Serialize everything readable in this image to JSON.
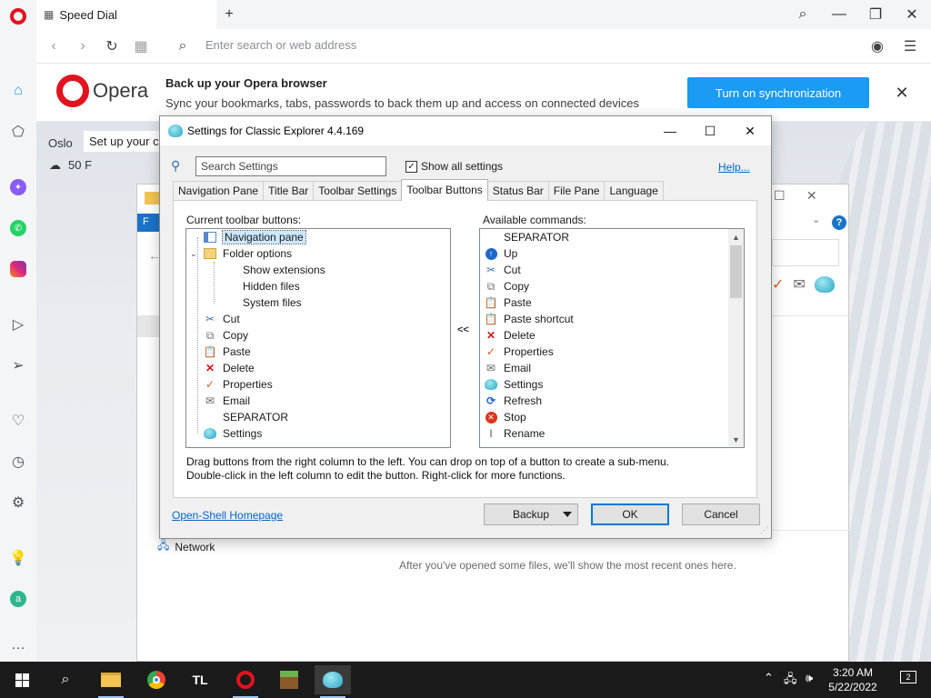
{
  "browser": {
    "tab_title": "Speed Dial",
    "address_placeholder": "Enter search or web address",
    "banner": {
      "logo_text": "Opera",
      "title": "Back up your Opera browser",
      "description": "Sync your bookmarks, tabs, passwords to back them up and access on connected devices",
      "button": "Turn on synchronization"
    },
    "weather": {
      "city": "Oslo",
      "hint": "Set up your city",
      "temperature": "50 F"
    },
    "accent": "#e0131f"
  },
  "explorer_window": {
    "ribbon_label": "F",
    "network_label": "Network",
    "recent_message": "After you've opened some files, we'll show the most recent ones here."
  },
  "dialog": {
    "title": "Settings for Classic Explorer 4.4.169",
    "search_placeholder": "Search Settings",
    "show_all_label": "Show all settings",
    "show_all_checked": true,
    "help_link": "Help...",
    "tabs": [
      {
        "label": "Navigation Pane",
        "active": false
      },
      {
        "label": "Title Bar",
        "active": false
      },
      {
        "label": "Toolbar Settings",
        "active": false
      },
      {
        "label": "Toolbar Buttons",
        "active": true
      },
      {
        "label": "Status Bar",
        "active": false
      },
      {
        "label": "File Pane",
        "active": false
      },
      {
        "label": "Language",
        "active": false
      }
    ],
    "current_label": "Current toolbar buttons:",
    "available_label": "Available commands:",
    "move_arrow": "<<",
    "current_items": [
      {
        "label": "Navigation pane",
        "icon": "nav-pane-icon",
        "level": 0,
        "selected": true
      },
      {
        "label": "Folder options",
        "icon": "folder-options-icon",
        "level": 0,
        "expanded": true
      },
      {
        "label": "Show extensions",
        "icon": "",
        "level": 1
      },
      {
        "label": "Hidden files",
        "icon": "",
        "level": 1
      },
      {
        "label": "System files",
        "icon": "",
        "level": 1
      },
      {
        "label": "Cut",
        "icon": "scissors-icon",
        "level": 0
      },
      {
        "label": "Copy",
        "icon": "copy-icon",
        "level": 0
      },
      {
        "label": "Paste",
        "icon": "paste-icon",
        "level": 0
      },
      {
        "label": "Delete",
        "icon": "delete-icon",
        "level": 0
      },
      {
        "label": "Properties",
        "icon": "checkmark-icon",
        "level": 0
      },
      {
        "label": "Email",
        "icon": "email-icon",
        "level": 0
      },
      {
        "label": "SEPARATOR",
        "icon": "",
        "level": 0
      },
      {
        "label": "Settings",
        "icon": "shell-icon",
        "level": 0
      }
    ],
    "available_items": [
      {
        "label": "SEPARATOR",
        "icon": ""
      },
      {
        "label": "Up",
        "icon": "up-arrow-icon"
      },
      {
        "label": "Cut",
        "icon": "scissors-icon"
      },
      {
        "label": "Copy",
        "icon": "copy-icon"
      },
      {
        "label": "Paste",
        "icon": "paste-icon"
      },
      {
        "label": "Paste shortcut",
        "icon": "paste-shortcut-icon"
      },
      {
        "label": "Delete",
        "icon": "delete-icon"
      },
      {
        "label": "Properties",
        "icon": "checkmark-icon"
      },
      {
        "label": "Email",
        "icon": "email-icon"
      },
      {
        "label": "Settings",
        "icon": "shell-icon"
      },
      {
        "label": "Refresh",
        "icon": "refresh-icon"
      },
      {
        "label": "Stop",
        "icon": "stop-icon"
      },
      {
        "label": "Rename",
        "icon": "rename-icon"
      }
    ],
    "hint_line1": "Drag buttons from the right column to the left. You can drop on top of a button to create a sub-menu.",
    "hint_line2": "Double-click in the left column to edit the button. Right-click for more functions.",
    "homepage_link": "Open-Shell Homepage",
    "backup_button": "Backup",
    "ok_button": "OK",
    "cancel_button": "Cancel"
  },
  "taskbar": {
    "time": "3:20 AM",
    "date": "5/22/2022",
    "notification_count": "2",
    "apps": [
      "start-icon",
      "search-icon",
      "file-explorer-icon",
      "chrome-icon",
      "tl-app-icon",
      "opera-icon",
      "minecraft-icon",
      "classic-shell-icon"
    ],
    "tl_label": "TL"
  }
}
